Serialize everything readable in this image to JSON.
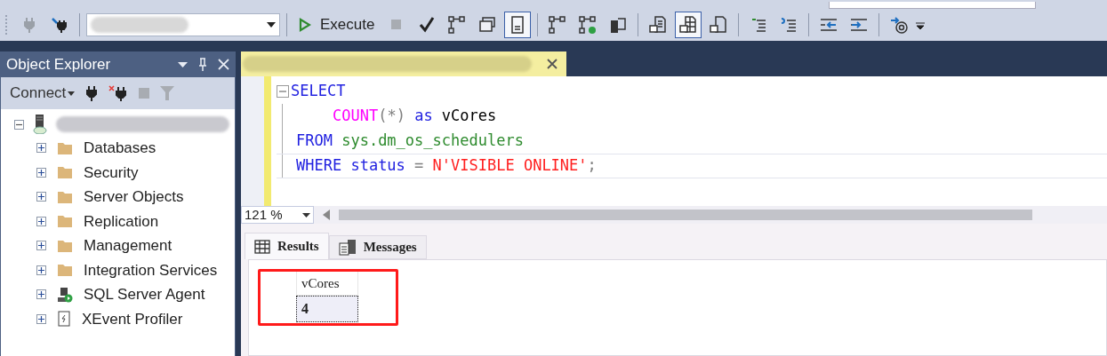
{
  "toolbar": {
    "buttons": [
      {
        "kind": "plug",
        "pressed": false
      },
      {
        "kind": "plug-edit",
        "pressed": false
      },
      {
        "kind": "database-select"
      },
      {
        "kind": "execute",
        "label": "Execute",
        "pressed": false
      },
      {
        "kind": "stop",
        "pressed": false
      },
      {
        "kind": "check",
        "pressed": false
      },
      {
        "kind": "diagram",
        "pressed": false
      },
      {
        "kind": "windows",
        "pressed": false
      },
      {
        "kind": "form",
        "pressed": true
      },
      {
        "kind": "diagram",
        "pressed": false
      },
      {
        "kind": "diagram-check",
        "pressed": false
      },
      {
        "kind": "server",
        "pressed": false
      },
      {
        "kind": "text-file",
        "pressed": false
      },
      {
        "kind": "grid-file",
        "pressed": true
      },
      {
        "kind": "file",
        "pressed": false
      },
      {
        "kind": "comment",
        "pressed": false
      },
      {
        "kind": "uncomment",
        "pressed": false
      },
      {
        "kind": "outdent",
        "pressed": false
      },
      {
        "kind": "indent",
        "pressed": false
      },
      {
        "kind": "at",
        "pressed": false
      }
    ]
  },
  "object_explorer": {
    "title": "Object Explorer",
    "connect_label": "Connect",
    "tree": {
      "expanded": true,
      "children": [
        {
          "label": "Databases",
          "kind": "folder",
          "expanded": false
        },
        {
          "label": "Security",
          "kind": "folder",
          "expanded": false
        },
        {
          "label": "Server Objects",
          "kind": "folder",
          "expanded": false
        },
        {
          "label": "Replication",
          "kind": "folder",
          "expanded": false
        },
        {
          "label": "Management",
          "kind": "folder",
          "expanded": false
        },
        {
          "label": "Integration Services",
          "kind": "folder",
          "expanded": false
        },
        {
          "label": "SQL Server Agent",
          "kind": "agent",
          "expanded": false
        },
        {
          "label": "XEvent Profiler",
          "kind": "profiler",
          "expanded": false
        }
      ]
    }
  },
  "editor": {
    "lines": [
      {
        "indented": false,
        "tokens": [
          {
            "text": "SELECT",
            "kind": "keyword"
          }
        ]
      },
      {
        "indented": true,
        "tokens": [
          {
            "text": "COUNT",
            "kind": "function"
          },
          {
            "text": "(*) ",
            "kind": "operator"
          },
          {
            "text": "as",
            "kind": "keyword"
          },
          {
            "text": " vCores",
            "kind": "plain"
          }
        ]
      },
      {
        "indented": false,
        "tokens": [
          {
            "text": "FROM ",
            "kind": "keyword"
          },
          {
            "text": "sys.dm_os_schedulers",
            "kind": "system"
          }
        ]
      },
      {
        "indented": false,
        "tokens": [
          {
            "text": "WHERE ",
            "kind": "keyword"
          },
          {
            "text": "status ",
            "kind": "keyword"
          },
          {
            "text": "= ",
            "kind": "operator"
          },
          {
            "text": "N'VISIBLE ONLINE'",
            "kind": "string"
          },
          {
            "text": ";",
            "kind": "operator"
          }
        ]
      }
    ],
    "zoom": "121 %"
  },
  "results": {
    "tabs": [
      {
        "label": "Results",
        "selected": true
      },
      {
        "label": "Messages",
        "selected": false
      }
    ],
    "highlighted": true,
    "columns": [
      "vCores"
    ],
    "rows": [
      [
        "4"
      ]
    ]
  }
}
